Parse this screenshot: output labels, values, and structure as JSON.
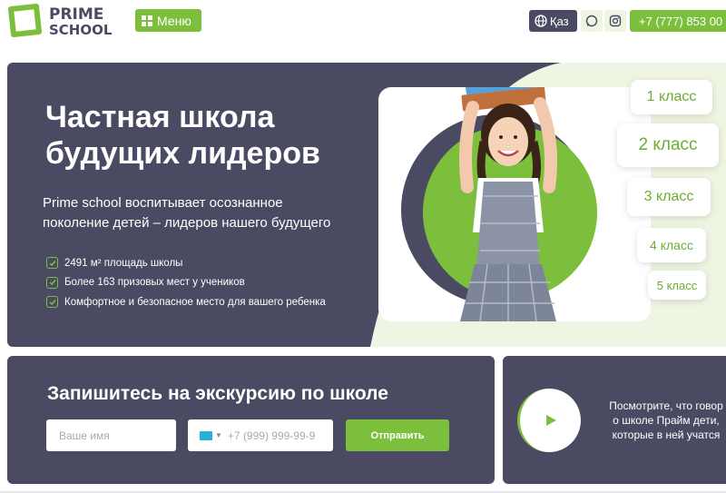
{
  "header": {
    "logo": {
      "line1": "PRIME",
      "line2": "SCHOOL"
    },
    "menu_label": "Меню",
    "lang_label": "Қаз",
    "phone": "+7 (777) 853 00",
    "icons": [
      "globe-icon",
      "whatsapp-icon",
      "instagram-icon",
      "grid-icon"
    ]
  },
  "hero": {
    "title_line1": "Частная школа",
    "title_line2": "будущих лидеров",
    "subtitle_line1": "Prime school воспитывает осознанное",
    "subtitle_line2": "поколение детей – лидеров нашего будущего",
    "features": [
      "2491 м² площадь школы",
      "Более 163 призовых мест у учеников",
      "Комфортное и безопасное место для вашего ребенка"
    ],
    "classes": [
      "1 класс",
      "2 класс",
      "3 класс",
      "4 класс",
      "5 класс"
    ]
  },
  "signup": {
    "title": "Запишитесь на экскурсию по школе",
    "name_placeholder": "Ваше имя",
    "phone_placeholder": "+7 (999) 999-99-9",
    "submit_label": "Отправить"
  },
  "video": {
    "line1": "Посмотрите, что говор",
    "line2": "о школе Прайм дети,",
    "line3": "которые в ней учатся"
  },
  "colors": {
    "accent": "#7cbf3c",
    "dark": "#4a4b63",
    "light_green": "#eef5e2"
  }
}
